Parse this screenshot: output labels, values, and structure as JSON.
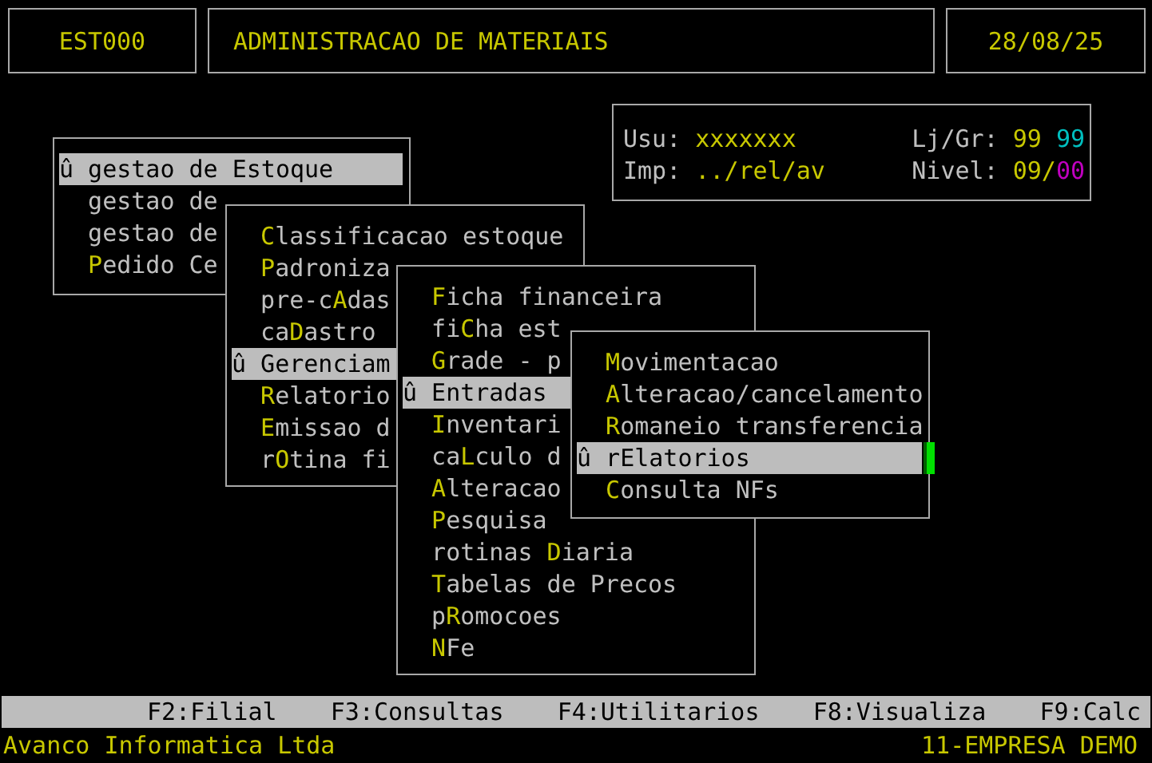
{
  "header": {
    "program": "EST000",
    "title": "ADMINISTRACAO DE MATERIAIS",
    "date": "28/08/25"
  },
  "info": {
    "rows": [
      {
        "label": "Usu:",
        "value": "xxxxxxx",
        "right_label": "Lj/Gr:",
        "right_parts": [
          {
            "text": "99",
            "color": "#c8c800"
          },
          {
            "text": "99",
            "color": "#00c0c0"
          }
        ]
      },
      {
        "label": "Imp:",
        "value": "../rel/av",
        "right_label": "Nivel:",
        "right_parts": [
          {
            "text": "09/",
            "color": "#c8c800"
          },
          {
            "text": "00",
            "color": "#c000c0"
          }
        ]
      }
    ]
  },
  "menus": [
    {
      "cursor": false,
      "items": [
        {
          "text": "û gestao de Estoque",
          "selected": true
        },
        {
          "text": "gestao de",
          "selected": false
        },
        {
          "text": "gestao de",
          "selected": false
        },
        {
          "text": "**P**edido Ce",
          "selected": false
        }
      ]
    },
    {
      "cursor": false,
      "items": [
        {
          "text": "**C**lassificacao estoque",
          "selected": false
        },
        {
          "text": "**P**adroniza",
          "selected": false
        },
        {
          "text": "pre-c**A**das",
          "selected": false
        },
        {
          "text": "ca**D**astro",
          "selected": false
        },
        {
          "text": "û Gerenciam",
          "selected": true
        },
        {
          "text": "**R**elatorio",
          "selected": false
        },
        {
          "text": "**E**missao d",
          "selected": false
        },
        {
          "text": "r**O**tina fi",
          "selected": false
        }
      ]
    },
    {
      "cursor": false,
      "items": [
        {
          "text": "**F**icha financeira",
          "selected": false
        },
        {
          "text": "fi**C**ha est",
          "selected": false
        },
        {
          "text": "**G**rade - p",
          "selected": false
        },
        {
          "text": "û Entradas",
          "selected": true
        },
        {
          "text": "**I**nventari",
          "selected": false
        },
        {
          "text": "ca**L**culo d",
          "selected": false
        },
        {
          "text": "**A**lteracao",
          "selected": false
        },
        {
          "text": "**P**esquisa",
          "selected": false
        },
        {
          "text": "rotinas **D**iaria",
          "selected": false
        },
        {
          "text": "**T**abelas de Precos",
          "selected": false
        },
        {
          "text": "p**R**omocoes",
          "selected": false
        },
        {
          "text": "**N**Fe",
          "selected": false
        }
      ]
    },
    {
      "cursor": true,
      "items": [
        {
          "text": "**M**ovimentacao",
          "selected": false
        },
        {
          "text": "**A**lteracao/cancelamento",
          "selected": false
        },
        {
          "text": "**R**omaneio transferencia",
          "selected": false
        },
        {
          "text": "û rElatorios",
          "selected": true
        },
        {
          "text": "**C**onsulta NFs",
          "selected": false
        }
      ]
    }
  ],
  "function_keys": [
    "F2:Filial",
    "F3:Consultas",
    "F4:Utilitarios",
    "F8:Visualiza",
    "F9:Calc"
  ],
  "status": {
    "left": "Avanco Informatica Ltda",
    "right": "11-EMPRESA DEMO"
  }
}
